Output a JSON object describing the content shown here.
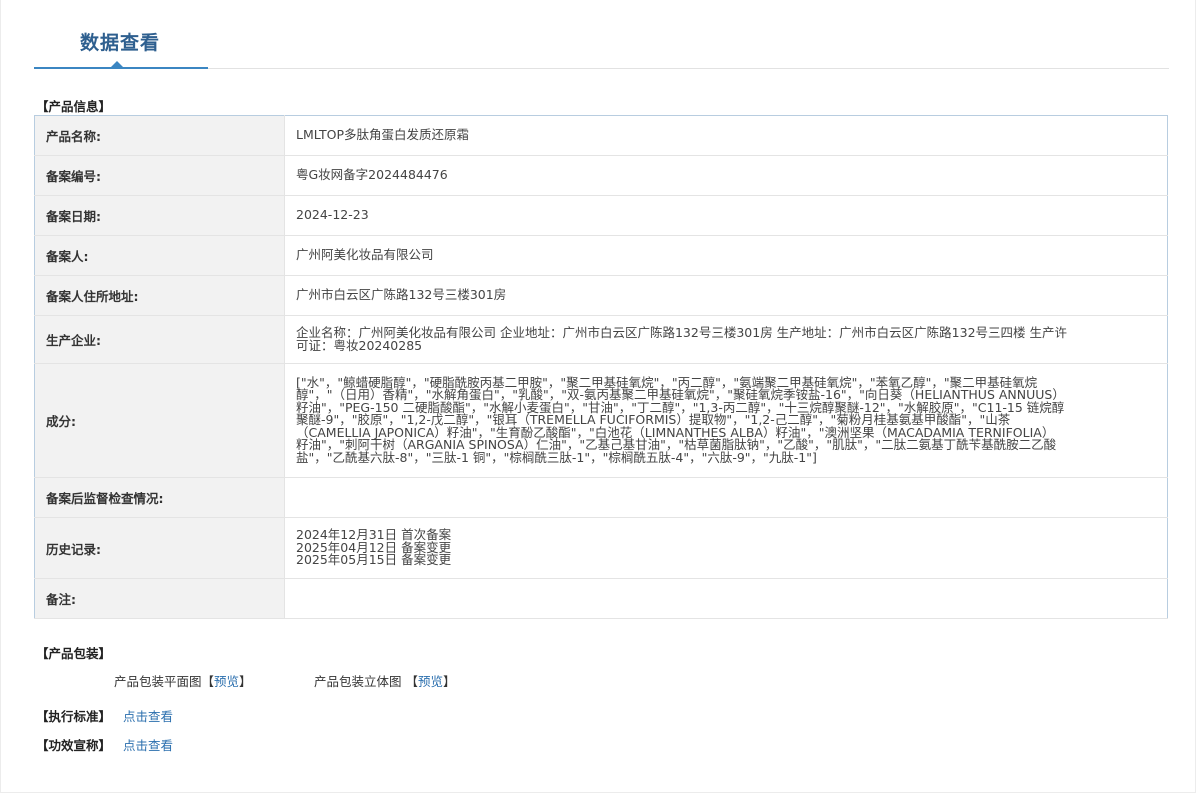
{
  "header": {
    "title": "数据查看"
  },
  "sections": {
    "product_info": "【产品信息】",
    "packaging": "【产品包装】",
    "standard": "【执行标准】",
    "efficacy": "【功效宣称】"
  },
  "table": [
    {
      "label": "产品名称:",
      "value": [
        "LMLTOP多肽角蛋白发质还原霜"
      ]
    },
    {
      "label": "备案编号:",
      "value": [
        "粤G妆网备字2024484476"
      ]
    },
    {
      "label": "备案日期:",
      "value": [
        "2024-12-23"
      ]
    },
    {
      "label": "备案人:",
      "value": [
        "广州阿美化妆品有限公司"
      ]
    },
    {
      "label": "备案人住所地址:",
      "value": [
        "广州市白云区广陈路132号三楼301房"
      ]
    },
    {
      "label": "生产企业:",
      "value": [
        "企业名称：广州阿美化妆品有限公司 企业地址：广州市白云区广陈路132号三楼301房 生产地址：广州市白云区广陈路132号三四楼 生产许",
        "可证：粤妆20240285"
      ]
    },
    {
      "label": "成分:",
      "value": [
        "[\"水\"，\"鲸蜡硬脂醇\"，\"硬脂酰胺丙基二甲胺\"，\"聚二甲基硅氧烷\"，\"丙二醇\"，\"氨端聚二甲基硅氧烷\"，\"苯氧乙醇\"，\"聚二甲基硅氧烷",
        "醇\"，\"（日用）香精\"，\"水解角蛋白\"，\"乳酸\"，\"双-氨丙基聚二甲基硅氧烷\"，\"聚硅氧烷季铵盐-16\"，\"向日葵（HELIANTHUS ANNUUS）",
        "籽油\"，\"PEG-150 二硬脂酸酯\"，\"水解小麦蛋白\"，\"甘油\"，\"丁二醇\"，\"1,3-丙二醇\"，\"十三烷醇聚醚-12\"，\"水解胶原\"，\"C11-15 链烷醇",
        "聚醚-9\"，\"胶原\"，\"1,2-戊二醇\"，\"银耳（TREMELLA FUCIFORMIS）提取物\"，\"1,2-己二醇\"，\"菊粉月桂基氨基甲酸酯\"，\"山茶",
        "（CAMELLIA JAPONICA）籽油\"，\"生育酚乙酸酯\"，\"白池花（LIMNANTHES ALBA）籽油\"，\"澳洲坚果（MACADAMIA TERNIFOLIA）",
        "籽油\"，\"刺阿干树（ARGANIA SPINOSA）仁油\"，\"乙基己基甘油\"，\"枯草菌脂肽钠\"，\"乙酸\"，\"肌肽\"，\"二肽二氨基丁酰苄基酰胺二乙酸",
        "盐\"，\"乙酰基六肽-8\"，\"三肽-1 铜\"，\"棕榈酰三肽-1\"，\"棕榈酰五肽-4\"，\"六肽-9\"，\"九肽-1\"]"
      ]
    },
    {
      "label": "备案后监督检查情况:",
      "value": [
        ""
      ]
    },
    {
      "label": "历史记录:",
      "value": [
        "2024年12月31日 首次备案",
        "2025年04月12日 备案变更",
        "2025年05月15日 备案变更"
      ]
    },
    {
      "label": "备注:",
      "value": [
        ""
      ]
    }
  ],
  "packaging": {
    "flat_label": "产品包装平面图",
    "solid_label": "产品包装立体图",
    "bracket_open": "【",
    "bracket_close": "】",
    "preview": "预览"
  },
  "links": {
    "view": "点击查看"
  }
}
